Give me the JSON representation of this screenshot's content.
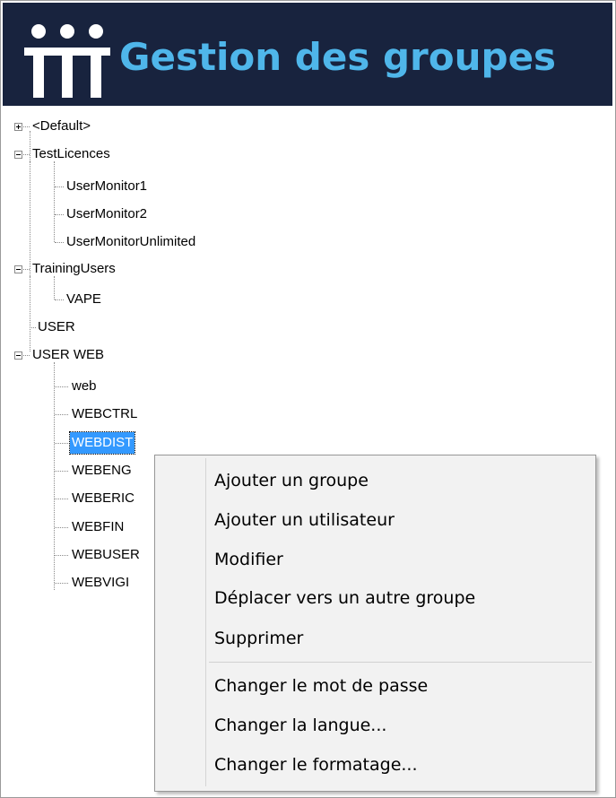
{
  "header": {
    "title": "Gestion des groupes",
    "logo_icon": "iii-logo-icon"
  },
  "tree": {
    "default": "<Default>",
    "test_licences": {
      "label": "TestLicences",
      "children": [
        "UserMonitor1",
        "UserMonitor2",
        "UserMonitorUnlimited"
      ]
    },
    "training_users": {
      "label": "TrainingUsers",
      "children": [
        "VAPE"
      ]
    },
    "user": "USER",
    "user_web": {
      "label": "USER WEB",
      "children": [
        "web",
        "WEBCTRL",
        "WEBDIST",
        "WEBENG",
        "WEBERIC",
        "WEBFIN",
        "WEBUSER",
        "WEBVIGI"
      ]
    },
    "selected": "WEBDIST"
  },
  "context_menu": {
    "items": [
      "Ajouter un groupe",
      "Ajouter un utilisateur",
      "Modifier",
      "Déplacer vers un autre groupe",
      "Supprimer",
      "Changer le mot de passe",
      "Changer la langue...",
      "Changer le formatage..."
    ]
  },
  "colors": {
    "header_bg": "#18233e",
    "title": "#4fb6ea",
    "selection": "#3399ff"
  }
}
